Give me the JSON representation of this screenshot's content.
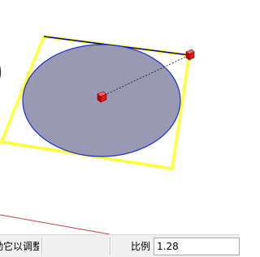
{
  "status_bar": {
    "hint": "动它以调整",
    "measurement_label": "比例",
    "measurement_value": "1.28"
  },
  "colors": {
    "selection_edge": "#ffff33",
    "selected_edge": "#000088",
    "circle_fill": "#9999b3",
    "circle_stroke": "#1a2fd0",
    "grip": "#dd1111",
    "axis_red": "#c04040"
  },
  "icons": {
    "scale_grip": "red-cube",
    "center_grip": "red-cube"
  }
}
